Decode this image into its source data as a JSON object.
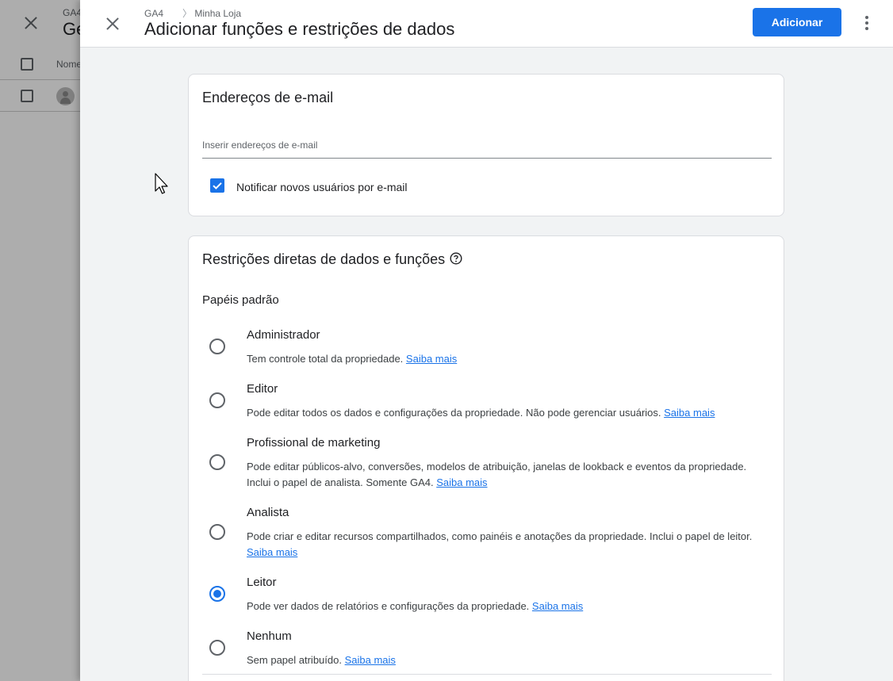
{
  "background": {
    "breadcrumb": "GA4",
    "title": "Ge",
    "column_name": "Nome"
  },
  "drawer": {
    "breadcrumb_property": "GA4",
    "breadcrumb_separator": "〉",
    "breadcrumb_account": "Minha Loja",
    "title": "Adicionar funções e restrições de dados",
    "add_label": "Adicionar",
    "more_icon": "more-vert-icon"
  },
  "email_card": {
    "title": "Endereços de e-mail",
    "input_value": "",
    "input_placeholder": "Inserir endereços de e-mail",
    "notify_checked": true,
    "notify_label": "Notificar novos usuários por e-mail"
  },
  "roles_card": {
    "title": "Restrições diretas de dados e funções",
    "help_icon": "help-circle-icon",
    "section_label": "Papéis padrão",
    "learn_more": "Saiba mais",
    "roles": [
      {
        "name": "Administrador",
        "description": "Tem controle total da propriedade.",
        "selected": false
      },
      {
        "name": "Editor",
        "description": "Pode editar todos os dados e configurações da propriedade. Não pode gerenciar usuários.",
        "selected": false
      },
      {
        "name": "Profissional de marketing",
        "description": "Pode editar públicos-alvo, conversões, modelos de atribuição, janelas de lookback e eventos da propriedade. Inclui o papel de analista. Somente GA4.",
        "selected": false
      },
      {
        "name": "Analista",
        "description": "Pode criar e editar recursos compartilhados, como painéis e anotações da propriedade. Inclui o papel de leitor.",
        "selected": false
      },
      {
        "name": "Leitor",
        "description": "Pode ver dados de relatórios e configurações da propriedade.",
        "selected": true
      },
      {
        "name": "Nenhum",
        "description": "Sem papel atribuído.",
        "selected": false
      }
    ]
  },
  "colors": {
    "accent": "#1a73e8",
    "text": "#202124",
    "secondary_text": "#5f6368"
  }
}
